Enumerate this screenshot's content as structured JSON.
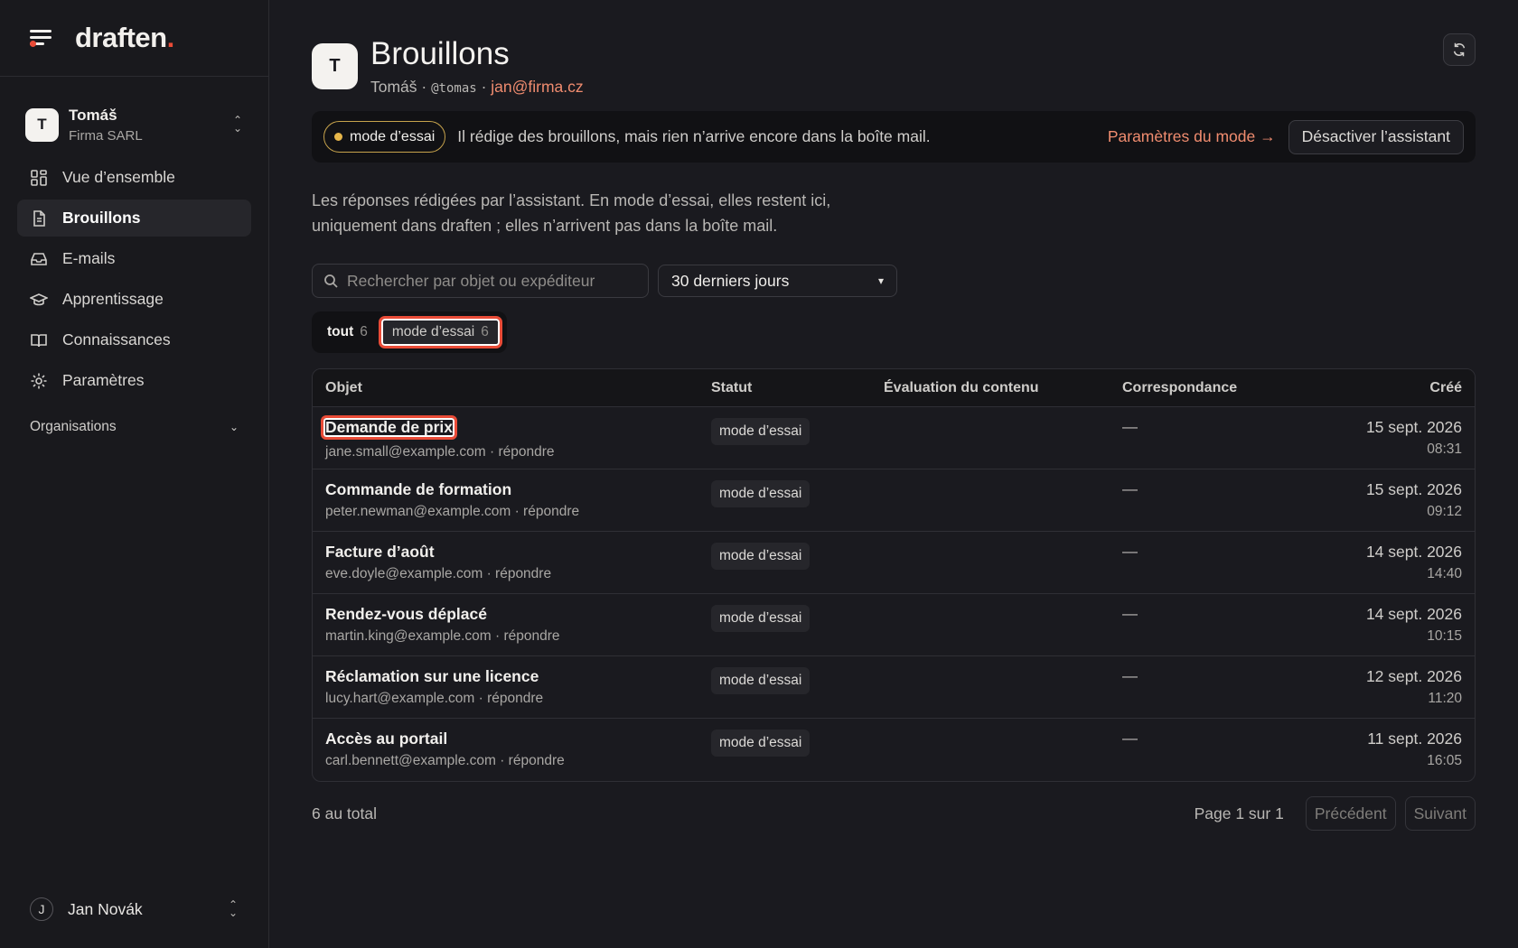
{
  "brand": {
    "logo_text": "draften",
    "logo_dot": ".",
    "accent_color": "#e94b37"
  },
  "org": {
    "avatar_letter": "T",
    "name": "Tomáš",
    "company": "Firma SARL"
  },
  "nav": [
    {
      "label": "Vue d’ensemble",
      "icon": "grid-icon"
    },
    {
      "label": "Brouillons",
      "icon": "document-icon",
      "active": true
    },
    {
      "label": "E-mails",
      "icon": "inbox-icon"
    },
    {
      "label": "Apprentissage",
      "icon": "graduation-cap-icon"
    },
    {
      "label": "Connaissances",
      "icon": "book-icon"
    },
    {
      "label": "Paramètres",
      "icon": "gear-icon"
    }
  ],
  "organisations_label": "Organisations",
  "user": {
    "avatar_letter": "J",
    "name": "Jan Novák"
  },
  "header": {
    "avatar_letter": "T",
    "title": "Brouillons",
    "user_name": "Tomáš",
    "separator": "·",
    "handle": "@tomas",
    "email": "jan@firma.cz"
  },
  "mode_banner": {
    "pill_label": "mode d’essai",
    "text": "Il rédige des brouillons, mais rien n’arrive encore dans la boîte mail.",
    "settings_link": "Paramètres du mode →",
    "disable_button": "Désactiver l’assistant"
  },
  "intro": {
    "line1": "Les réponses rédigées par l’assistant. En mode d’essai, elles restent ici,",
    "line2": "uniquement dans draften ; elles n’arrivent pas dans la boîte mail."
  },
  "search": {
    "placeholder": "Rechercher par objet ou expéditeur",
    "value": ""
  },
  "period_select": {
    "selected": "30 derniers jours"
  },
  "tabs": [
    {
      "label": "tout",
      "count": "6"
    },
    {
      "label": "mode d’essai",
      "count": "6"
    }
  ],
  "table": {
    "columns": [
      "Objet",
      "Statut",
      "Évaluation du contenu",
      "Correspondance",
      "Créé"
    ],
    "rows": [
      {
        "subject": "Demande de prix",
        "sender": "jane.small@example.com · répondre",
        "status": "mode d’essai",
        "evaluation": "",
        "match": "—",
        "date": "15 sept. 2026",
        "time": "08:31"
      },
      {
        "subject": "Commande de formation",
        "sender": "peter.newman@example.com · répondre",
        "status": "mode d’essai",
        "evaluation": "",
        "match": "—",
        "date": "15 sept. 2026",
        "time": "09:12"
      },
      {
        "subject": "Facture d’août",
        "sender": "eve.doyle@example.com · répondre",
        "status": "mode d’essai",
        "evaluation": "",
        "match": "—",
        "date": "14 sept. 2026",
        "time": "14:40"
      },
      {
        "subject": "Rendez-vous déplacé",
        "sender": "martin.king@example.com · répondre",
        "status": "mode d’essai",
        "evaluation": "",
        "match": "—",
        "date": "14 sept. 2026",
        "time": "10:15"
      },
      {
        "subject": "Réclamation sur une licence",
        "sender": "lucy.hart@example.com · répondre",
        "status": "mode d’essai",
        "evaluation": "",
        "match": "—",
        "date": "12 sept. 2026",
        "time": "11:20"
      },
      {
        "subject": "Accès au portail",
        "sender": "carl.bennett@example.com · répondre",
        "status": "mode d’essai",
        "evaluation": "",
        "match": "—",
        "date": "11 sept. 2026",
        "time": "16:05"
      }
    ]
  },
  "footer": {
    "total": "6 au total",
    "page_info": "Page 1 sur 1",
    "prev": "Précédent",
    "next": "Suivant"
  }
}
